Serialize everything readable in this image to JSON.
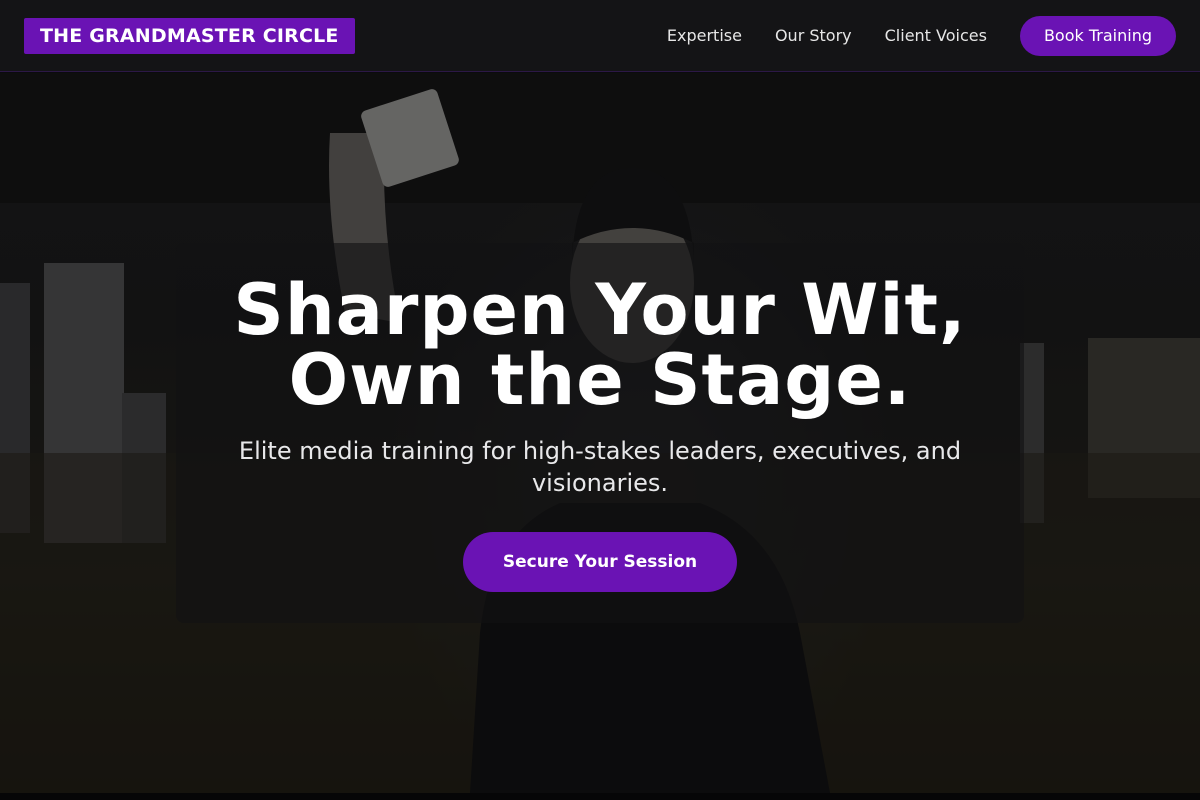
{
  "header": {
    "logo": "THE GRANDMASTER CIRCLE",
    "nav": [
      "Expertise",
      "Our Story",
      "Client Voices"
    ],
    "cta": "Book Training"
  },
  "hero": {
    "title_line1": "Sharpen Your Wit,",
    "title_line2": "Own the Stage.",
    "subtitle": "Elite media training for high-stakes leaders, executives, and visionaries.",
    "cta": "Secure Your Session",
    "background": "man in black beanie and jacket holding a smartphone up, under a concrete overpass"
  },
  "colors": {
    "accent": "#6a13b4",
    "nav_bg": "#141416",
    "text": "#ffffff"
  }
}
